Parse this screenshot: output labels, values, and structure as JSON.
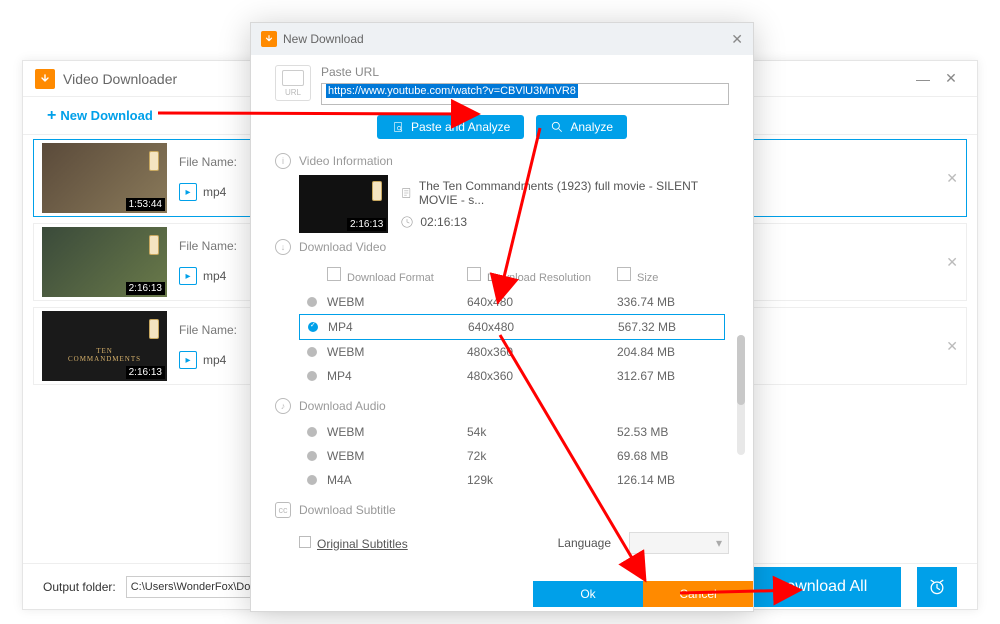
{
  "main": {
    "title": "Video Downloader",
    "new_download_label": "New Download",
    "items": [
      {
        "duration": "1:53:44",
        "file_name_label": "File Name:",
        "format_label": "mp4",
        "active": true
      },
      {
        "duration": "2:16:13",
        "file_name_label": "File Name:",
        "format_label": "mp4",
        "active": false
      },
      {
        "duration": "2:16:13",
        "file_name_label": "File Name:",
        "format_label": "mp4",
        "active": false
      }
    ],
    "output_folder_label": "Output folder:",
    "output_folder_value": "C:\\Users\\WonderFox\\Documents",
    "download_all_label": "Download All"
  },
  "dialog": {
    "title": "New Download",
    "url_section": {
      "label": "Paste URL",
      "value": "https://www.youtube.com/watch?v=CBVlU3MnVR8",
      "paste_btn": "Paste and Analyze",
      "analyze_btn": "Analyze",
      "url_icon_text": "URL"
    },
    "video_info": {
      "header": "Video Information",
      "title": "The Ten Commandments (1923) full movie - SILENT MOVIE - s...",
      "duration": "02:16:13",
      "thumb_duration": "2:16:13"
    },
    "download_video": {
      "header": "Download Video",
      "columns": {
        "format": "Download Format",
        "resolution": "Download Resolution",
        "size": "Size"
      },
      "rows": [
        {
          "format": "WEBM",
          "resolution": "640x480",
          "size": "336.74 MB",
          "selected": false
        },
        {
          "format": "MP4",
          "resolution": "640x480",
          "size": "567.32 MB",
          "selected": true
        },
        {
          "format": "WEBM",
          "resolution": "480x360",
          "size": "204.84 MB",
          "selected": false
        },
        {
          "format": "MP4",
          "resolution": "480x360",
          "size": "312.67 MB",
          "selected": false
        }
      ]
    },
    "download_audio": {
      "header": "Download Audio",
      "rows": [
        {
          "format": "WEBM",
          "resolution": "54k",
          "size": "52.53 MB"
        },
        {
          "format": "WEBM",
          "resolution": "72k",
          "size": "69.68 MB"
        },
        {
          "format": "M4A",
          "resolution": "129k",
          "size": "126.14 MB"
        }
      ]
    },
    "subtitle": {
      "header": "Download Subtitle",
      "original_label": "Original Subtitles",
      "language_label": "Language"
    },
    "footer": {
      "ok": "Ok",
      "cancel": "Cancel"
    }
  }
}
